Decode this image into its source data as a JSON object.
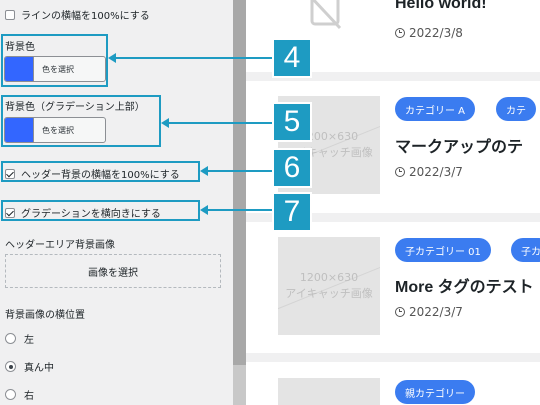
{
  "settings": {
    "line_full_width": "ラインの横幅を100%にする",
    "bg_color_label": "背景色",
    "bg_color_button": "色を選択",
    "bg_gradient_label": "背景色（グラデーション上部）",
    "bg_gradient_button": "色を選択",
    "header_full_width": "ヘッダー背景の横幅を100%にする",
    "gradient_horizontal": "グラデーションを横向きにする",
    "header_image_label": "ヘッダーエリア背景画像",
    "header_image_button": "画像を選択",
    "bg_position_label": "背景画像の横位置",
    "radio_options": [
      "左",
      "真ん中",
      "右"
    ],
    "selected_position": "真ん中",
    "swatch_color": "#3366ff"
  },
  "callouts": [
    "4",
    "5",
    "6",
    "7"
  ],
  "accent_color": "#1e9bc2",
  "posts": [
    {
      "title": "Hello world!",
      "date": "2022/3/8",
      "categories": []
    },
    {
      "title": "マークアップのテ",
      "date": "2022/3/7",
      "categories": [
        "カテゴリー A",
        "カテ"
      ],
      "thumb_lines": [
        "1200×630",
        "アイキャッチ画像"
      ]
    },
    {
      "title": "More タグのテスト",
      "date": "2022/3/7",
      "categories": [
        "子カテゴリー 01",
        "子カ"
      ],
      "thumb_lines": [
        "1200×630",
        "アイキャッチ画像"
      ]
    },
    {
      "title": "",
      "date": "",
      "categories": [
        "親カテゴリー"
      ]
    }
  ]
}
